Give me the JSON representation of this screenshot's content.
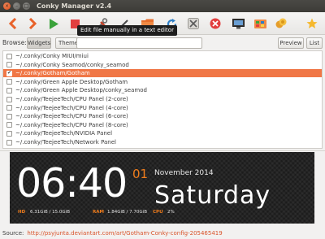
{
  "window": {
    "title": "Conky Manager v2.4"
  },
  "toolbar": {
    "tooltip": "Edit file manually in a text editor",
    "colors": {
      "accent": "#f07746",
      "play": "#3ba33b",
      "stop": "#e23f3f"
    }
  },
  "browse": {
    "label": "Browse:",
    "widgets_button": "Widgets",
    "themes_button": "Themes",
    "search_value": "",
    "preview_button": "Preview",
    "list_button": "List"
  },
  "list": {
    "items": [
      {
        "label": "~/.conky/Conky MIUI/miui",
        "checked": false,
        "selected": false
      },
      {
        "label": "~/.conky/Conky Seamod/conky_seamod",
        "checked": false,
        "selected": false
      },
      {
        "label": "~/.conky/Gotham/Gotham",
        "checked": true,
        "selected": true
      },
      {
        "label": "~/.conky/Green Apple Desktop/Gotham",
        "checked": false,
        "selected": false
      },
      {
        "label": "~/.conky/Green Apple Desktop/conky_seamod",
        "checked": false,
        "selected": false
      },
      {
        "label": "~/.conky/TeejeeTech/CPU Panel (2-core)",
        "checked": false,
        "selected": false
      },
      {
        "label": "~/.conky/TeejeeTech/CPU Panel (4-core)",
        "checked": false,
        "selected": false
      },
      {
        "label": "~/.conky/TeejeeTech/CPU Panel (6-core)",
        "checked": false,
        "selected": false
      },
      {
        "label": "~/.conky/TeejeeTech/CPU Panel (8-core)",
        "checked": false,
        "selected": false
      },
      {
        "label": "~/.conky/TeejeeTech/NVIDIA Panel",
        "checked": false,
        "selected": false
      },
      {
        "label": "~/.conky/TeejeeTech/Network Panel",
        "checked": false,
        "selected": false
      }
    ]
  },
  "preview": {
    "time": "06:40",
    "day_number": "01",
    "month_year": "November 2014",
    "weekday": "Saturday",
    "hd_label": "HD",
    "hd_value": "6.31GiB / 15.0GiB",
    "ram_label": "RAM",
    "ram_value": "1.84GiB / 7.70GiB",
    "cpu_label": "CPU",
    "cpu_value": "2%"
  },
  "status": {
    "label": "Source:",
    "link": "http://psyjunta.deviantart.com/art/Gotham-Conky-config-205465419"
  }
}
